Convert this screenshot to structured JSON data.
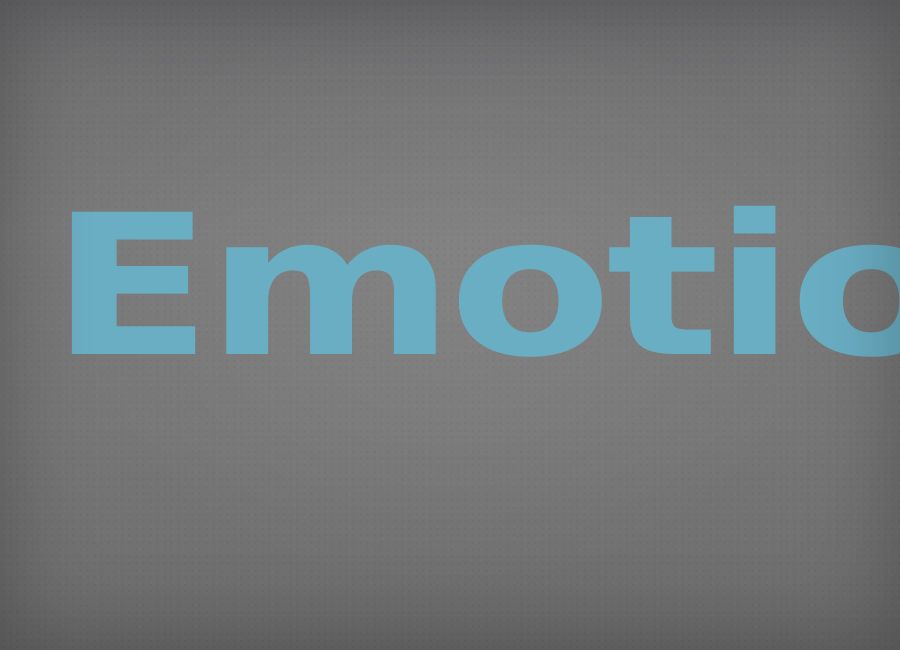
{
  "title": {
    "text": "Emotion",
    "color": "#6aaec4"
  },
  "background": {
    "color": "#757575"
  }
}
